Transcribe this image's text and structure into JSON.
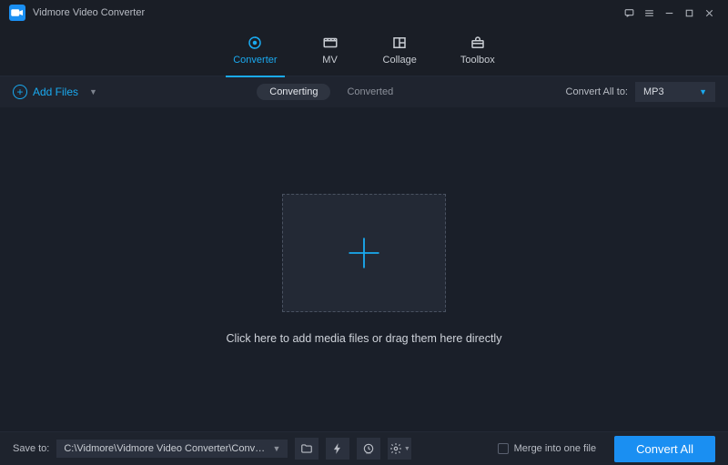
{
  "app": {
    "title": "Vidmore Video Converter"
  },
  "nav": {
    "tabs": {
      "converter": "Converter",
      "mv": "MV",
      "collage": "Collage",
      "toolbox": "Toolbox"
    }
  },
  "toolbar": {
    "add_files": "Add Files",
    "segments": {
      "converting": "Converting",
      "converted": "Converted"
    },
    "convert_all_to_label": "Convert All to:",
    "format_selected": "MP3"
  },
  "main": {
    "hint": "Click here to add media files or drag them here directly"
  },
  "bottom": {
    "save_to_label": "Save to:",
    "save_path": "C:\\Vidmore\\Vidmore Video Converter\\Converted",
    "merge_label": "Merge into one file",
    "convert_all": "Convert All"
  }
}
